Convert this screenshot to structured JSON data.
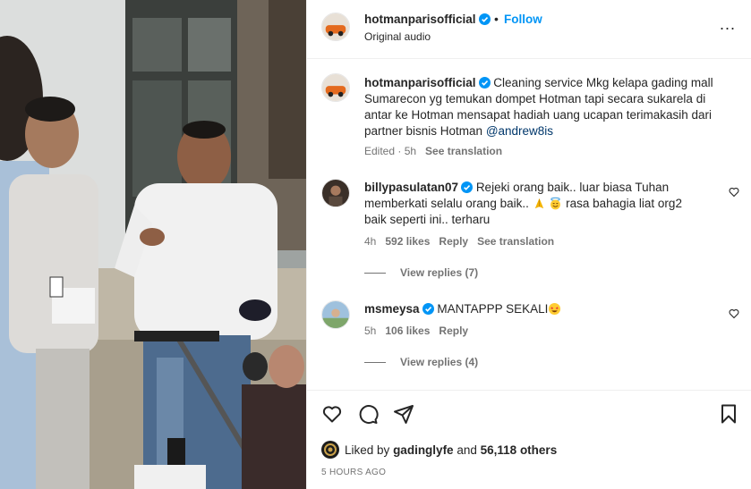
{
  "header": {
    "username": "hotmanparisofficial",
    "separator": "•",
    "follow_label": "Follow",
    "audio": "Original audio",
    "more": "..."
  },
  "caption": {
    "username": "hotmanparisofficial",
    "text": "Cleaning service Mkg kelapa gading mall Sumarecon yg temukan dompet Hotman tapi secara sukarela di antar ke Hotman mensapat hadiah uang ucapan terimakasih dari partner bisnis Hotman ",
    "mention": "@andrew8is",
    "edited": "Edited · 5h",
    "see_translation": "See translation"
  },
  "comments": [
    {
      "username": "billypasulatan07",
      "text_line1": "Rejeki orang baik.. luar biasa Tuhan",
      "text_line2a": "memberkati selalu orang baik.. ",
      "text_line2b": " rasa bahagia liat org2",
      "text_line3": "baik seperti ini.. terharu",
      "time": "4h",
      "likes": "592 likes",
      "reply": "Reply",
      "see_translation": "See translation",
      "view_replies": "View replies (7)"
    },
    {
      "username": "msmeysa",
      "text": "MANTAPPP SEKALI",
      "time": "5h",
      "likes": "106 likes",
      "reply": "Reply",
      "view_replies": "View replies (4)"
    }
  ],
  "footer": {
    "liked_prefix": "Liked by ",
    "liked_user": "gadinglyfe",
    "liked_mid": " and ",
    "liked_count": "56,118 others",
    "time_ago": "5 HOURS AGO"
  },
  "icons": {
    "like": "heart-icon",
    "comment": "comment-bubble-icon",
    "share": "send-icon",
    "save": "bookmark-icon"
  },
  "colors": {
    "accent": "#0095f6",
    "verified": "#0095f6",
    "muted": "#737373",
    "mention": "#00376b"
  }
}
